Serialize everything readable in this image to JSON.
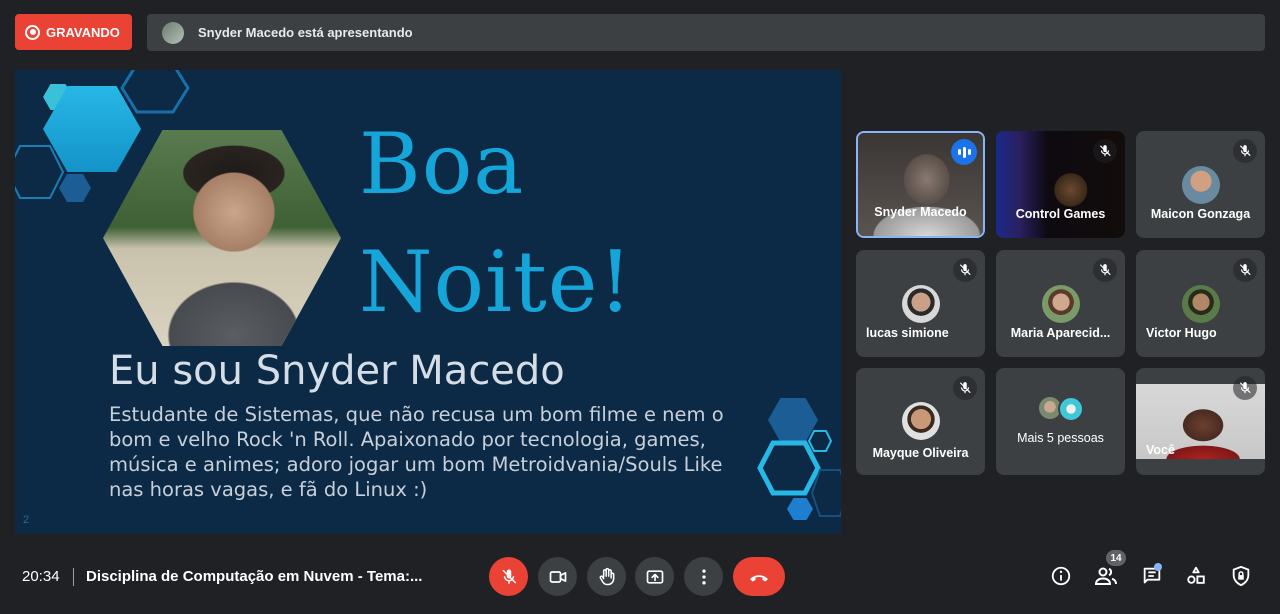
{
  "top": {
    "recording_label": "GRAVANDO",
    "presenting_text": "Snyder Macedo está apresentando"
  },
  "slide": {
    "greeting_line1": "Boa",
    "greeting_line2": "Noite!",
    "headline": "Eu sou Snyder Macedo",
    "bio": "Estudante de Sistemas, que não recusa um bom filme e nem o bom e velho Rock 'n Roll. Apaixonado por tecnologia, games, música e animes; adoro jogar um bom Metroidvania/Souls Like nas horas vagas, e fã do Linux :)",
    "page_number": "2"
  },
  "participants": [
    {
      "name": "Snyder Macedo",
      "state": "speaking"
    },
    {
      "name": "Control Games",
      "state": "muted"
    },
    {
      "name": "Maicon Gonzaga",
      "state": "muted"
    },
    {
      "name": "lucas simione",
      "state": "muted"
    },
    {
      "name": "Maria Aparecid...",
      "state": "muted"
    },
    {
      "name": "Victor Hugo",
      "state": "muted"
    },
    {
      "name": "Mayque Oliveira",
      "state": "muted"
    },
    {
      "name": "Mais 5 pessoas",
      "state": "group"
    },
    {
      "name": "Você",
      "state": "muted"
    }
  ],
  "bottom": {
    "time": "20:34",
    "meeting_title": "Disciplina de Computação em Nuvem - Tema:...",
    "participants_count": "14"
  },
  "colors": {
    "accent_red": "#ea4335",
    "slide_bg": "#0c2a45",
    "slide_accent": "#16a5d8",
    "speaking_blue": "#1a73e8"
  },
  "icons": [
    "record-icon",
    "mic-off-icon",
    "camera-icon",
    "raise-hand-icon",
    "present-icon",
    "more-options-icon",
    "hang-up-icon",
    "info-icon",
    "people-icon",
    "chat-icon",
    "activities-icon",
    "host-controls-icon"
  ]
}
